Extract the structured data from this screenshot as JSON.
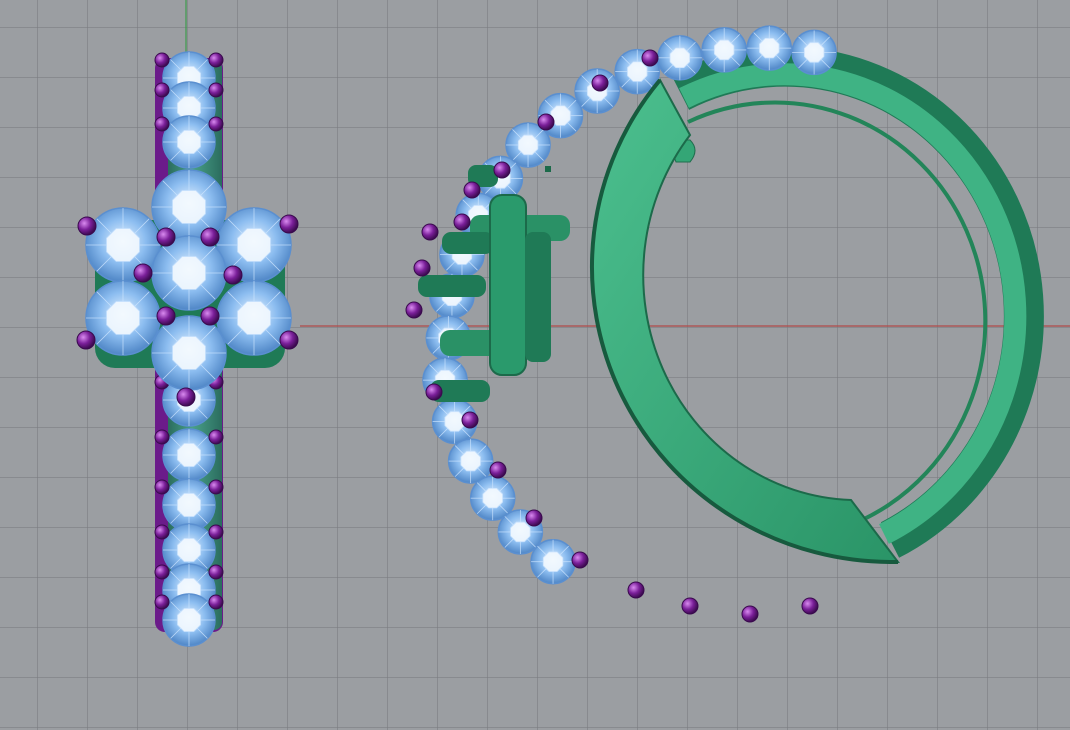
{
  "viewport": {
    "projection": "orthographic",
    "view": "front",
    "display_mode": "shaded",
    "grid": true,
    "colors": {
      "background": "#9b9ea2",
      "grid_line": "#7f8286",
      "x_axis": "#b04a4a",
      "y_axis": "#3c9a4c",
      "metal": "#36a97a",
      "metal_dark": "#1f7a56",
      "metal_light": "#6fd3a6",
      "prong": "#7a1f99",
      "prong_light": "#c46ae0",
      "gem": "#8cbdf0",
      "gem_wire": "#c9e3ff"
    }
  },
  "objects": [
    {
      "name": "ring-front-view",
      "icon": "flower-cluster-ring"
    },
    {
      "name": "ring-side-view",
      "icon": "hinged-hoop-ring"
    }
  ]
}
